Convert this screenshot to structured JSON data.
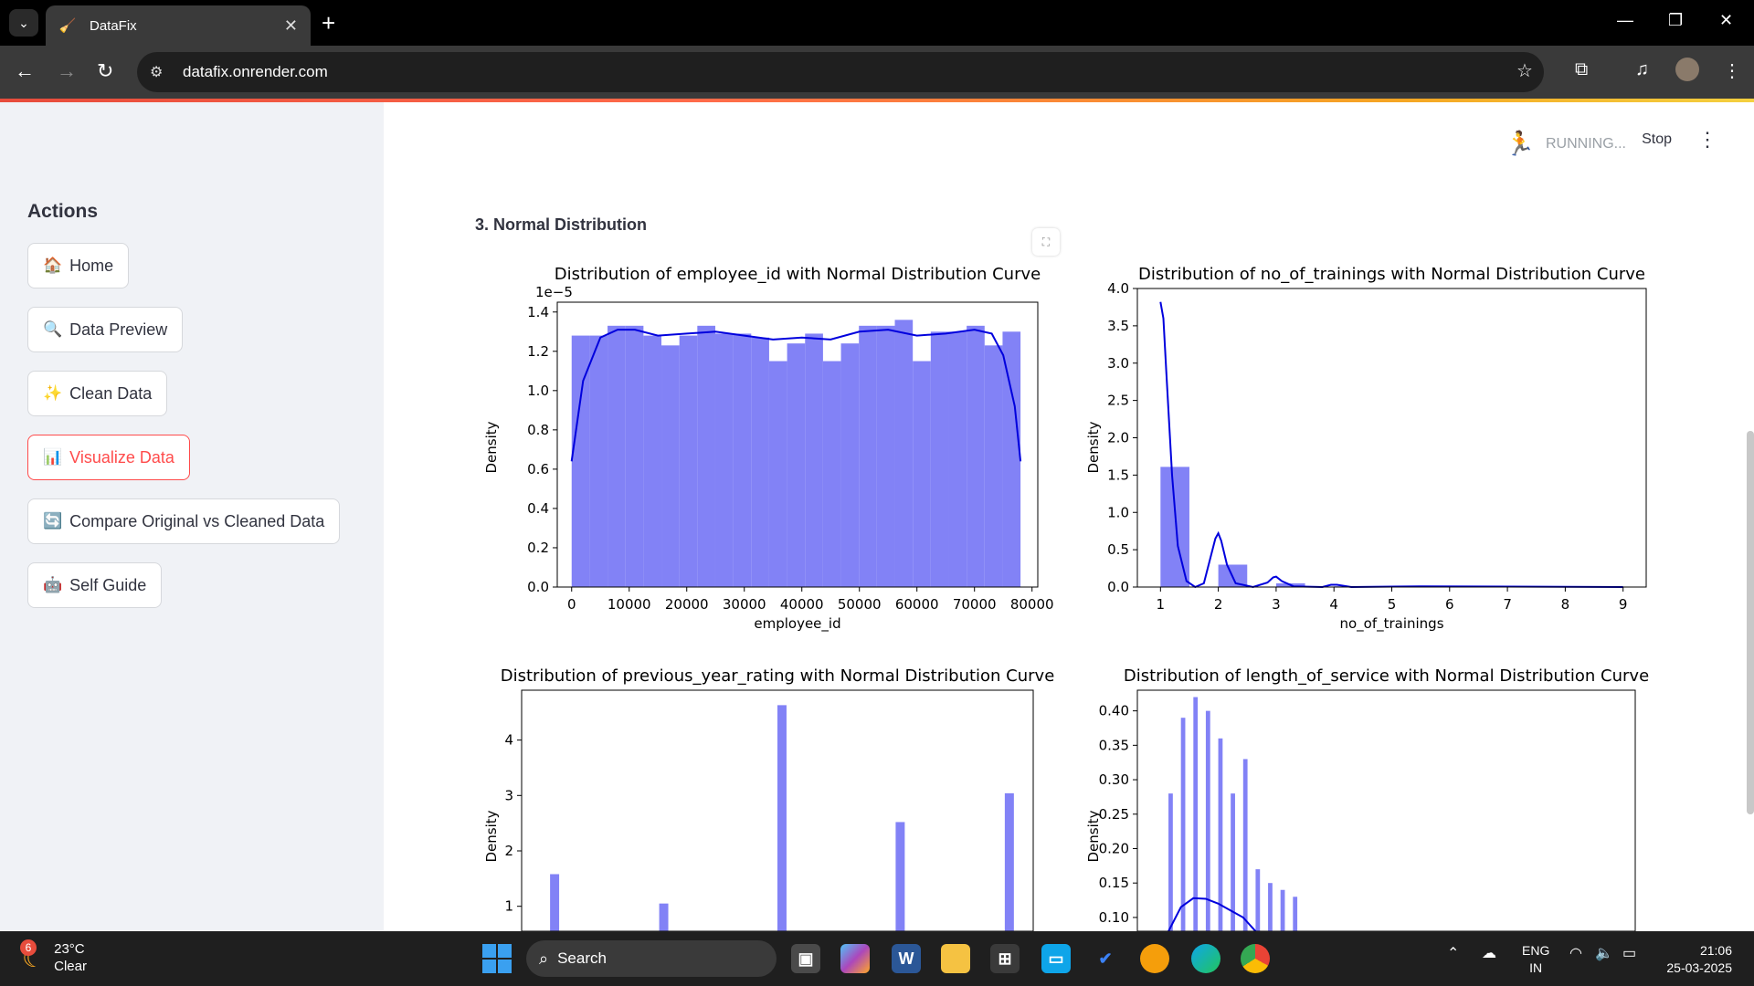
{
  "browser": {
    "tab_title": "DataFix",
    "url": "datafix.onrender.com"
  },
  "sidebar": {
    "title": "Actions",
    "items": [
      {
        "label": "Home",
        "icon": "🏠"
      },
      {
        "label": "Data Preview",
        "icon": "🔍"
      },
      {
        "label": "Clean Data",
        "icon": "✨"
      },
      {
        "label": "Visualize Data",
        "icon": "📊",
        "active": true
      },
      {
        "label": "Compare Original vs Cleaned Data",
        "icon": "🔄"
      },
      {
        "label": "Self Guide",
        "icon": "🤖"
      }
    ]
  },
  "status": {
    "running": "RUNNING...",
    "stop": "Stop"
  },
  "section_title": "3. Normal Distribution",
  "chart_data": [
    {
      "type": "bar",
      "title": "Distribution of employee_id with Normal Distribution Curve",
      "xlabel": "employee_id",
      "ylabel": "Density",
      "scale_label": "1e−5",
      "xlim": [
        -2500,
        81000
      ],
      "ylim": [
        0,
        1.45
      ],
      "x_ticks": [
        "0",
        "10000",
        "20000",
        "30000",
        "40000",
        "50000",
        "60000",
        "70000",
        "80000"
      ],
      "y_ticks": [
        "0.0",
        "0.2",
        "0.4",
        "0.6",
        "0.8",
        "1.0",
        "1.2",
        "1.4"
      ],
      "bar_width": 3120,
      "bar_starts": [
        0,
        3120,
        6240,
        9360,
        12480,
        15600,
        18720,
        21840,
        24960,
        28080,
        31200,
        34320,
        37440,
        40560,
        43680,
        46800,
        49920,
        53040,
        56160,
        59280,
        62400,
        65520,
        68640,
        71760,
        74880
      ],
      "values": [
        1.28,
        1.28,
        1.33,
        1.33,
        1.28,
        1.23,
        1.28,
        1.33,
        1.29,
        1.29,
        1.27,
        1.15,
        1.24,
        1.29,
        1.15,
        1.24,
        1.33,
        1.33,
        1.36,
        1.15,
        1.3,
        1.3,
        1.33,
        1.23,
        1.3
      ],
      "curve_x": [
        0,
        2000,
        5000,
        8000,
        11000,
        15000,
        20000,
        25000,
        30000,
        35000,
        40000,
        45000,
        50000,
        55000,
        60000,
        65000,
        70000,
        73000,
        75000,
        77000,
        78000
      ],
      "curve_y": [
        0.64,
        1.05,
        1.27,
        1.31,
        1.31,
        1.28,
        1.29,
        1.3,
        1.28,
        1.26,
        1.27,
        1.26,
        1.3,
        1.31,
        1.28,
        1.29,
        1.31,
        1.29,
        1.18,
        0.92,
        0.64
      ]
    },
    {
      "type": "bar",
      "title": "Distribution of no_of_trainings with Normal Distribution Curve",
      "xlabel": "no_of_trainings",
      "ylabel": "Density",
      "xlim": [
        0.6,
        9.4
      ],
      "ylim": [
        0,
        4.0
      ],
      "x_ticks": [
        "1",
        "2",
        "3",
        "4",
        "5",
        "6",
        "7",
        "8",
        "9"
      ],
      "y_ticks": [
        "0.0",
        "0.5",
        "1.0",
        "1.5",
        "2.0",
        "2.5",
        "3.0",
        "3.5",
        "4.0"
      ],
      "bar_width": 0.5,
      "bar_starts": [
        1.0,
        2.0,
        3.0,
        4.0
      ],
      "values": [
        1.61,
        0.3,
        0.05,
        0.01
      ],
      "curve_x": [
        1.0,
        1.05,
        1.1,
        1.2,
        1.3,
        1.45,
        1.6,
        1.75,
        1.85,
        1.95,
        2.0,
        2.05,
        2.15,
        2.3,
        2.6,
        2.85,
        2.95,
        3.0,
        3.1,
        3.3,
        3.8,
        3.95,
        4.05,
        4.3,
        5.5,
        9.0
      ],
      "curve_y": [
        3.82,
        3.6,
        2.9,
        1.5,
        0.55,
        0.08,
        0.0,
        0.05,
        0.35,
        0.65,
        0.72,
        0.62,
        0.3,
        0.05,
        0.0,
        0.06,
        0.13,
        0.14,
        0.08,
        0.01,
        0.0,
        0.03,
        0.03,
        0.0,
        0.01,
        0.0
      ]
    },
    {
      "type": "bar",
      "title": "Distribution of previous_year_rating with Normal Distribution Curve",
      "xlabel": "",
      "ylabel": "Density",
      "xlim": [
        0.75,
        5.25
      ],
      "ylim": [
        0.55,
        4.9
      ],
      "y_ticks": [
        "1",
        "2",
        "3",
        "4"
      ],
      "bar_width": 0.08,
      "bar_starts": [
        1.0,
        1.96,
        3.0,
        4.04,
        5.0
      ],
      "values": [
        1.58,
        1.05,
        4.63,
        2.52,
        3.04
      ]
    },
    {
      "type": "bar",
      "title": "Distribution of length_of_service with Normal Distribution Curve",
      "xlabel": "",
      "ylabel": "Density",
      "xlim": [
        0,
        40
      ],
      "ylim": [
        0.08,
        0.43
      ],
      "y_ticks": [
        "0.10",
        "0.15",
        "0.20",
        "0.25",
        "0.30",
        "0.35",
        "0.40"
      ],
      "bar_width": 0.35,
      "bar_starts": [
        2.5,
        3.5,
        4.5,
        5.5,
        6.5,
        7.5,
        8.5,
        9.5,
        10.5,
        11.5,
        12.5
      ],
      "values": [
        0.28,
        0.39,
        0.42,
        0.4,
        0.36,
        0.28,
        0.33,
        0.17,
        0.15,
        0.14,
        0.13
      ],
      "curve_x": [
        2.5,
        3.5,
        4.5,
        5.5,
        6.5,
        7.5,
        8.5,
        9.0,
        9.5
      ],
      "curve_y": [
        0.08,
        0.115,
        0.128,
        0.127,
        0.12,
        0.11,
        0.1,
        0.09,
        0.08
      ]
    }
  ],
  "taskbar": {
    "weather_temp": "23°C",
    "weather_desc": "Clear",
    "weather_badge": "6",
    "search_placeholder": "Search",
    "lang_1": "ENG",
    "lang_2": "IN",
    "time": "21:06",
    "date": "25-03-2025"
  }
}
